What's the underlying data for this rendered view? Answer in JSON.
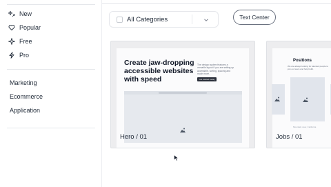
{
  "sidebar": {
    "nav": [
      {
        "label": "New",
        "icon": "sparkle-arrow-icon"
      },
      {
        "label": "Popular",
        "icon": "heart-icon"
      },
      {
        "label": "Free",
        "icon": "sparkle-icon"
      },
      {
        "label": "Pro",
        "icon": "lightning-icon"
      }
    ],
    "categories": [
      "Marketing",
      "Ecommerce",
      "Application"
    ]
  },
  "toolbar": {
    "category_select": {
      "value": "All Categories"
    },
    "filter_pill": "Text Center"
  },
  "cards": [
    {
      "label": "Hero / 01",
      "preview": {
        "headline": "Create jaw-dropping accessible websites with speed",
        "body": "The design system features a versatile layout if you are setting up accessible, sorting, spacing and much more.",
        "button": "Get started today"
      }
    },
    {
      "label": "Jobs / 01",
      "preview": {
        "headline": "Positions",
        "body": "We are always looking for talented people to join our team and help build.",
        "footer": "Mountain view, California"
      }
    }
  ],
  "colors": {
    "border": "#e5e7eb",
    "card_bg": "#ededef",
    "text": "#1f2937",
    "button_dark": "#2a2f3a"
  }
}
